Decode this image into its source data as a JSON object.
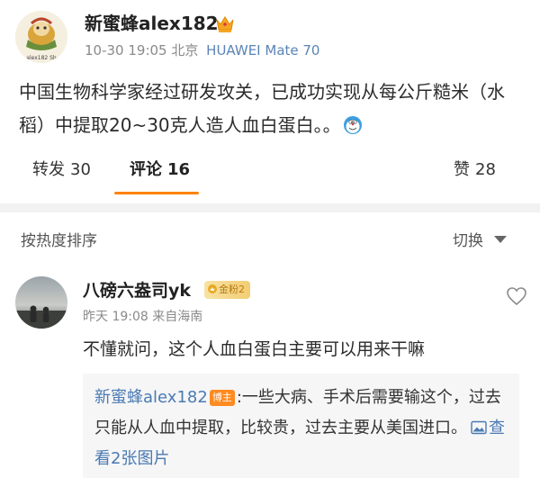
{
  "post": {
    "author_name": "新蜜蜂alex182",
    "time": "10-30 19:05",
    "location": "北京",
    "device": "HUAWEI Mate 70",
    "avatar_text": "alex182 Sh",
    "body_text": "中国生物科学家经过研发攻关，已成功实现从每公斤糙米（水稻）中提取20~30克人造人血白蛋白。。",
    "crown_icon": "crown-icon",
    "emoji_icon": "doraemon-emoji-icon"
  },
  "tabs": {
    "repost_label": "转发",
    "repost_count": "30",
    "comment_label": "评论",
    "comment_count": "16",
    "like_label": "赞",
    "like_count": "28",
    "accent_color": "#ff8200"
  },
  "sort_bar": {
    "sort_label": "按热度排序",
    "switch_label": "切换"
  },
  "comments": [
    {
      "name": "八磅六盎司yk",
      "badge": "金粉2",
      "time": "昨天 19:08",
      "location": "来自海南",
      "text": "不懂就问，这个人血白蛋白主要可以用来干嘛",
      "reply": {
        "author": "新蜜蜂alex182",
        "badge": "博主",
        "text": ":一些大病、手术后需要输这个，过去只能从人血中提取，比较贵，过去主要从美国进口。",
        "link_text": "查看2张图片"
      }
    }
  ],
  "colors": {
    "link": "#4a7ab3",
    "device": "#5b84b5",
    "op_badge": "#ff8a1f"
  }
}
